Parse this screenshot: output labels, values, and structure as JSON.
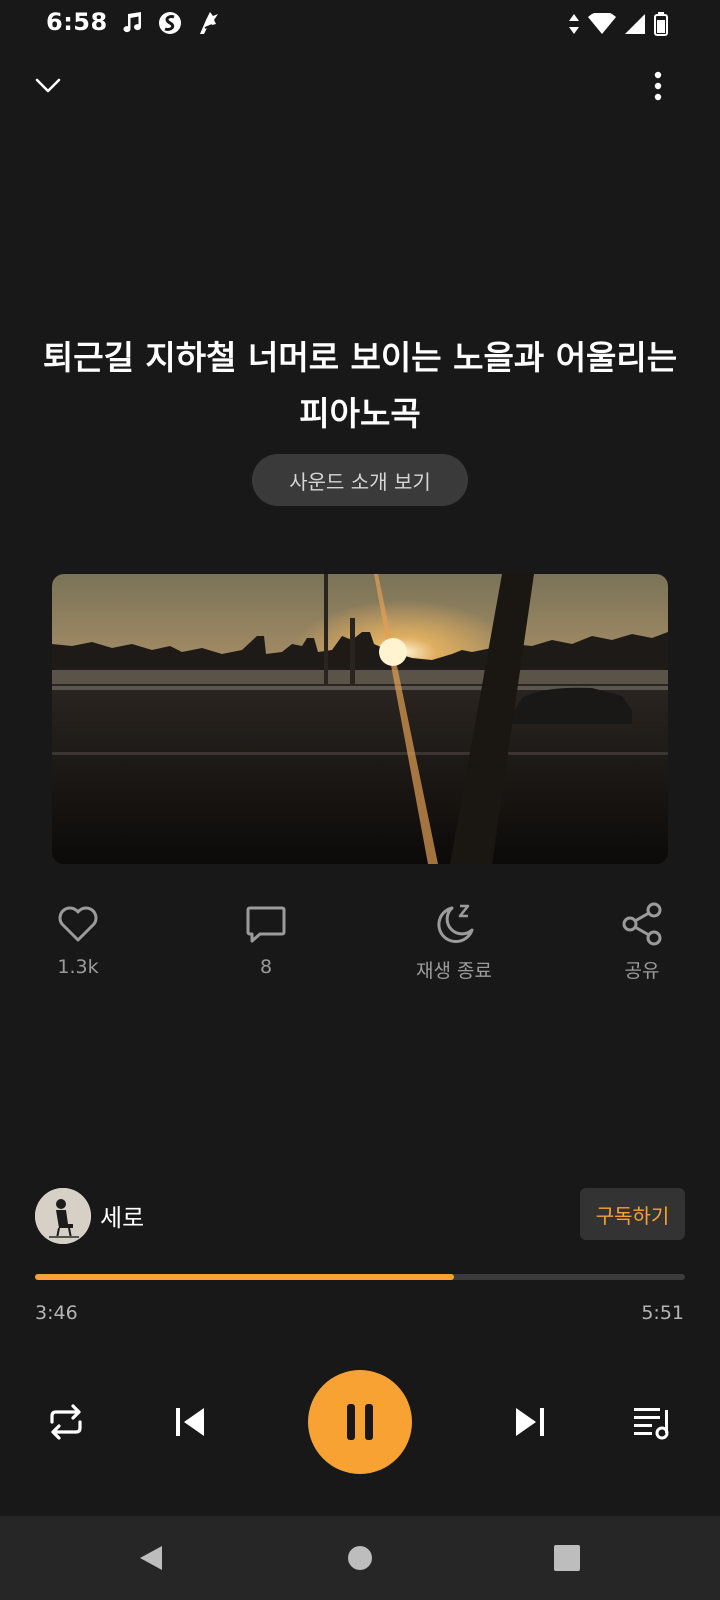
{
  "status_bar": {
    "time": "6:58",
    "left_icons": [
      "music-note-icon",
      "app-s-icon",
      "app-bird-icon"
    ],
    "right_icons": [
      "data-arrows-icon",
      "wifi-icon",
      "signal-icon",
      "battery-icon"
    ]
  },
  "header": {
    "collapse_icon": "chevron-down-icon",
    "more_icon": "more-vertical-icon"
  },
  "track": {
    "title": "퇴근길 지하철 너머로 보이는 노을과 어울리는 피아노곡",
    "intro_button_label": "사운드 소개 보기"
  },
  "actions": {
    "like_count": "1.3k",
    "comment_count": "8",
    "sleep_timer_label": "재생 종료",
    "share_label": "공유"
  },
  "artist": {
    "name": "세로",
    "subscribe_label": "구독하기"
  },
  "playback": {
    "elapsed": "3:46",
    "total": "5:51",
    "progress_fraction": 0.644,
    "state": "playing"
  },
  "controls": [
    "repeat-icon",
    "previous-icon",
    "pause-icon",
    "next-icon",
    "queue-icon"
  ],
  "nav": [
    "back-icon",
    "home-icon",
    "recents-icon"
  ],
  "colors": {
    "accent": "#f7a233",
    "background": "#181818",
    "chip": "#3a3a3a",
    "nav_bar": "#262626"
  }
}
